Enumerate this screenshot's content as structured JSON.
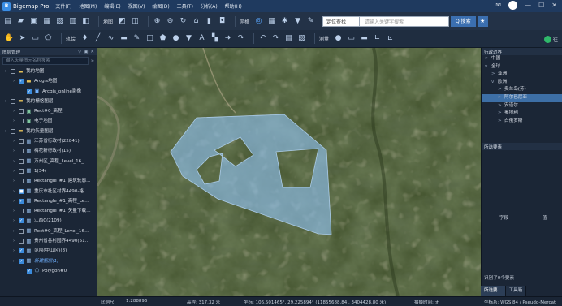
{
  "app": {
    "title": "Bigemap Pro",
    "logo_letter": "B"
  },
  "menu": [
    "文件(F)",
    "地图(M)",
    "编辑(E)",
    "视图(V)",
    "绘图(D)",
    "工具(T)",
    "分析(A)",
    "帮助(H)"
  ],
  "window_controls": {
    "minimize": "—",
    "maximize": "☐",
    "close": "✕"
  },
  "toolbar1": {
    "map_label": "地图",
    "grid_label": "网格",
    "search_type": "定位查找",
    "search_placeholder": "请输入关键字搜索",
    "search_button": "Q 搜索",
    "favorite": "★"
  },
  "toolbar2": {
    "draw_label": "轨绘",
    "measure_label": "测量"
  },
  "left_panel": {
    "title": "图层管理",
    "search_placeholder": "输入矢量图元名称搜索",
    "items": [
      {
        "label": "我的地图",
        "level": 0,
        "checked": "",
        "icon": "folder"
      },
      {
        "label": "Arcgis地图",
        "level": 1,
        "checked": "✓",
        "icon": "folder"
      },
      {
        "label": "Arcgis_online影像",
        "level": 2,
        "checked": "✓",
        "icon": "map"
      },
      {
        "label": "我的栅格图层",
        "level": 0,
        "checked": "",
        "icon": "folder"
      },
      {
        "label": "Rect#0_高程",
        "level": 1,
        "checked": "",
        "icon": "raster"
      },
      {
        "label": "电子地图",
        "level": 1,
        "checked": "",
        "icon": "raster"
      },
      {
        "label": "我的矢量图层",
        "level": 0,
        "checked": "",
        "icon": "folder"
      },
      {
        "label": "江苏省行政村(22841)",
        "level": 1,
        "checked": "",
        "icon": "vector"
      },
      {
        "label": "梅花新行政村(15)",
        "level": 1,
        "checked": "",
        "icon": "vector"
      },
      {
        "label": "万州区_高程_Level_16_...",
        "level": 1,
        "checked": "",
        "icon": "vector"
      },
      {
        "label": "1(34)",
        "level": 1,
        "checked": "",
        "icon": "vector"
      },
      {
        "label": "Rectangle_#1_建筑轮廓...",
        "level": 1,
        "checked": "",
        "icon": "vector"
      },
      {
        "label": "重庆市社区村界4490-格...",
        "level": 1,
        "checked": "■",
        "icon": "vector"
      },
      {
        "label": "Rectangle_#1_高程_Lev...",
        "level": 1,
        "checked": "✓",
        "icon": "vector"
      },
      {
        "label": "Rectangle_#1_矢量下载(...",
        "level": 1,
        "checked": "",
        "icon": "vector"
      },
      {
        "label": "江西C(2109)",
        "level": 1,
        "checked": "✓",
        "icon": "vector"
      },
      {
        "label": "Rect#0_高程_Level_16_...",
        "level": 1,
        "checked": "",
        "icon": "vector"
      },
      {
        "label": "贵州省各村园界4490(51)...",
        "level": 1,
        "checked": "",
        "icon": "vector"
      },
      {
        "label": "范围(中山区)(8)",
        "level": 1,
        "checked": "✓",
        "icon": "vector"
      },
      {
        "label": "新建图层(1)",
        "level": 1,
        "checked": "✓",
        "icon": "vector",
        "accent": true
      },
      {
        "label": "Polygon#0",
        "level": 2,
        "checked": "✓",
        "icon": "polygon"
      }
    ]
  },
  "right_panel": {
    "title": "行政边界",
    "tree": [
      {
        "label": "中国",
        "level": 0,
        "arrow": ">",
        "selected": false
      },
      {
        "label": "全球",
        "level": 0,
        "arrow": "v",
        "selected": false
      },
      {
        "label": "亚洲",
        "level": 1,
        "arrow": ">",
        "selected": false
      },
      {
        "label": "欧洲",
        "level": 1,
        "arrow": "v",
        "selected": false
      },
      {
        "label": "奥兰岛(芬)",
        "level": 2,
        "arrow": ">",
        "selected": false
      },
      {
        "label": "阿尔巴尼亚",
        "level": 2,
        "arrow": ">",
        "selected": true
      },
      {
        "label": "安道尔",
        "level": 2,
        "arrow": ">",
        "selected": false
      },
      {
        "label": "奥地利",
        "level": 2,
        "arrow": ">",
        "selected": false
      },
      {
        "label": "白俄罗斯",
        "level": 2,
        "arrow": ">",
        "selected": false
      }
    ],
    "selection_title": "所选要素",
    "field_header": "字段",
    "value_header": "值",
    "selection_count": "识别了0个要素",
    "tabs": [
      "所选要...",
      "工具箱"
    ]
  },
  "status": {
    "scale_label": "比例尺:",
    "scale_value": "1:288896",
    "elevation": "高程: 317.32 米",
    "coords": "坐标: 106.501465°, 29.225894° (11855688.84 , 3404428.80 米)",
    "snap": "拍摄时间: 无",
    "crs": "坐标系: WGS 84 / Pseudo-Mercat"
  },
  "colors": {
    "accent": "#3b8bdc",
    "polygon_fill": "#7fb3e8",
    "selected": "#3d6fa6"
  }
}
